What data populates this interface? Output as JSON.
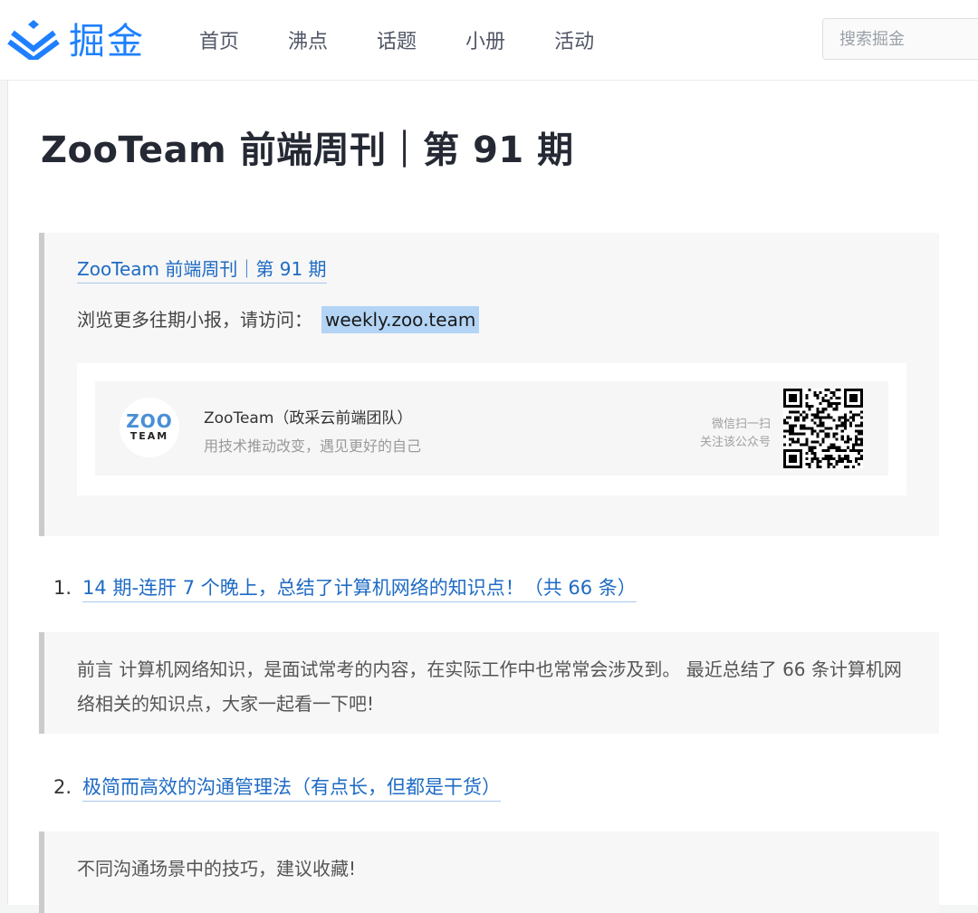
{
  "header": {
    "logo_text": "掘金",
    "nav": [
      "首页",
      "沸点",
      "话题",
      "小册",
      "活动"
    ],
    "search_placeholder": "搜索掘金",
    "brand_color": "#1e80ff"
  },
  "article": {
    "title": "ZooTeam 前端周刊｜第 91 期",
    "intro": {
      "link": "ZooTeam 前端周刊｜第 91 期",
      "visit_text": "浏览更多往期小报，请访问：",
      "visit_url": "weekly.zoo.team"
    },
    "profile": {
      "avatar_top": "ZOO",
      "avatar_bottom": "TEAM",
      "name": "ZooTeam（政采云前端团队）",
      "desc": "用技术推动改变，遇见更好的自己",
      "scan_line1": "微信扫一扫",
      "scan_line2": "关注该公众号"
    },
    "items": [
      {
        "num": "1.",
        "title": "14 期-连肝 7 个晚上，总结了计算机网络的知识点！（共 66 条）",
        "summary": "前言 计算机网络知识，是面试常考的内容，在实际工作中也常常会涉及到。 最近总结了 66 条计算机网络相关的知识点，大家一起看一下吧!"
      },
      {
        "num": "2.",
        "title": "极简而高效的沟通管理法（有点长，但都是干货）",
        "summary": "不同沟通场景中的技巧，建议收藏!"
      }
    ]
  }
}
